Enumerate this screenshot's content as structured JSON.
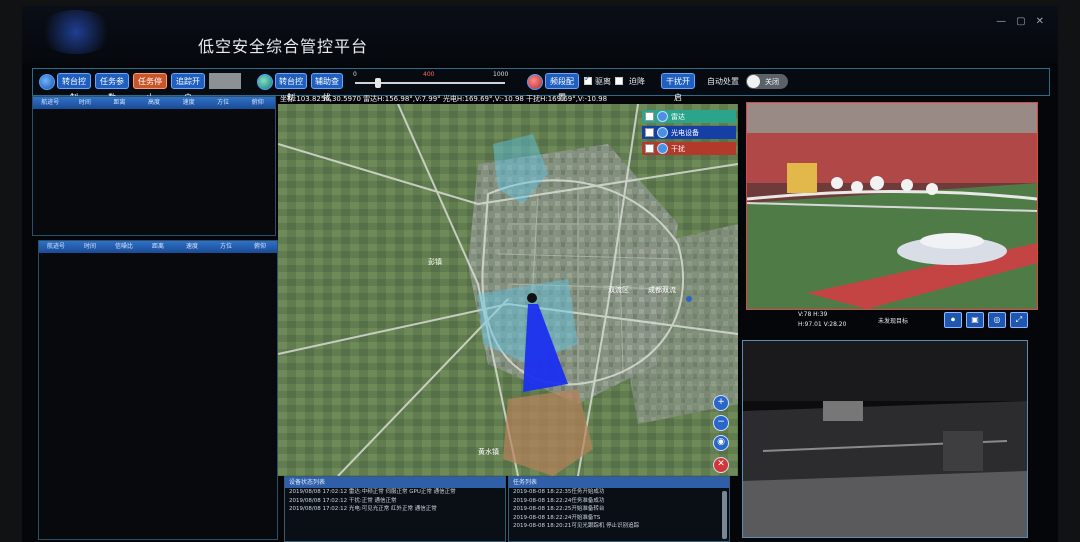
{
  "app": {
    "title": "低空安全综合管控平台"
  },
  "toolbar": {
    "btn_turret": "转台控制",
    "btn_task_params": "任务参数",
    "btn_task_stop": "任务停止",
    "btn_track_start": "追踪开启",
    "btn_turret2": "转台控制",
    "btn_assist": "辅助查找",
    "slider_min": "0",
    "slider_mid": "400",
    "slider_max": "1000",
    "btn_freq_config": "频段配置",
    "label_drive": "驱离",
    "label_landing": "迫降",
    "btn_jam_start": "干扰开启",
    "label_auto": "自动处置",
    "toggle_state": "关闭"
  },
  "track_table_top": {
    "headers": [
      "航迹号",
      "时间",
      "距离",
      "高度",
      "速度",
      "方位",
      "俯仰"
    ]
  },
  "track_table_bottom": {
    "headers": [
      "航迹号",
      "时间",
      "信噪比",
      "距离",
      "速度",
      "方位",
      "俯仰"
    ]
  },
  "map": {
    "coord_line": "坐标:103.8256,30.5970  雷达H:156.98°,V:7.99°  光电H:169.69°,V:-10.98  干扰H:169.69°,V:-10.98",
    "layers": [
      {
        "label": "雷达"
      },
      {
        "label": "光电设备"
      },
      {
        "label": "干扰"
      }
    ],
    "place_labels": [
      "彭镇",
      "成都双流",
      "黄水镇",
      "双流区"
    ],
    "colors": {
      "radar_beam": "#1a2ff0",
      "coverage": "#5fc8e8",
      "zone": "#b8825a"
    }
  },
  "status_panel": {
    "title": "设备状态列表",
    "lines": [
      "2019/08/08 17:02:12 雷达:中频正常 伺服正常 GPU正常 通信正常",
      "2019/08/08 17:02:12 干扰:正常 通信正常",
      "2019/08/08 17:02:12 光电:可见光正常 红外正常 通信正常"
    ]
  },
  "task_panel": {
    "title": "任务列表",
    "lines": [
      "2019-08-08 18:22:35任务开始成功",
      "2019-08-08 18:22:24任务准备成功",
      "2019-08-08 18:22:25开始准备转台",
      "2019-08-08 18:22:24开始准备TS",
      "2019-08-08 18:20:21可见光跟踪机 停止识别追踪"
    ]
  },
  "camera": {
    "info_line1": "V:78 H:39",
    "info_line2": "H:97.01 V:28.20",
    "target_status": "未发现目标"
  }
}
